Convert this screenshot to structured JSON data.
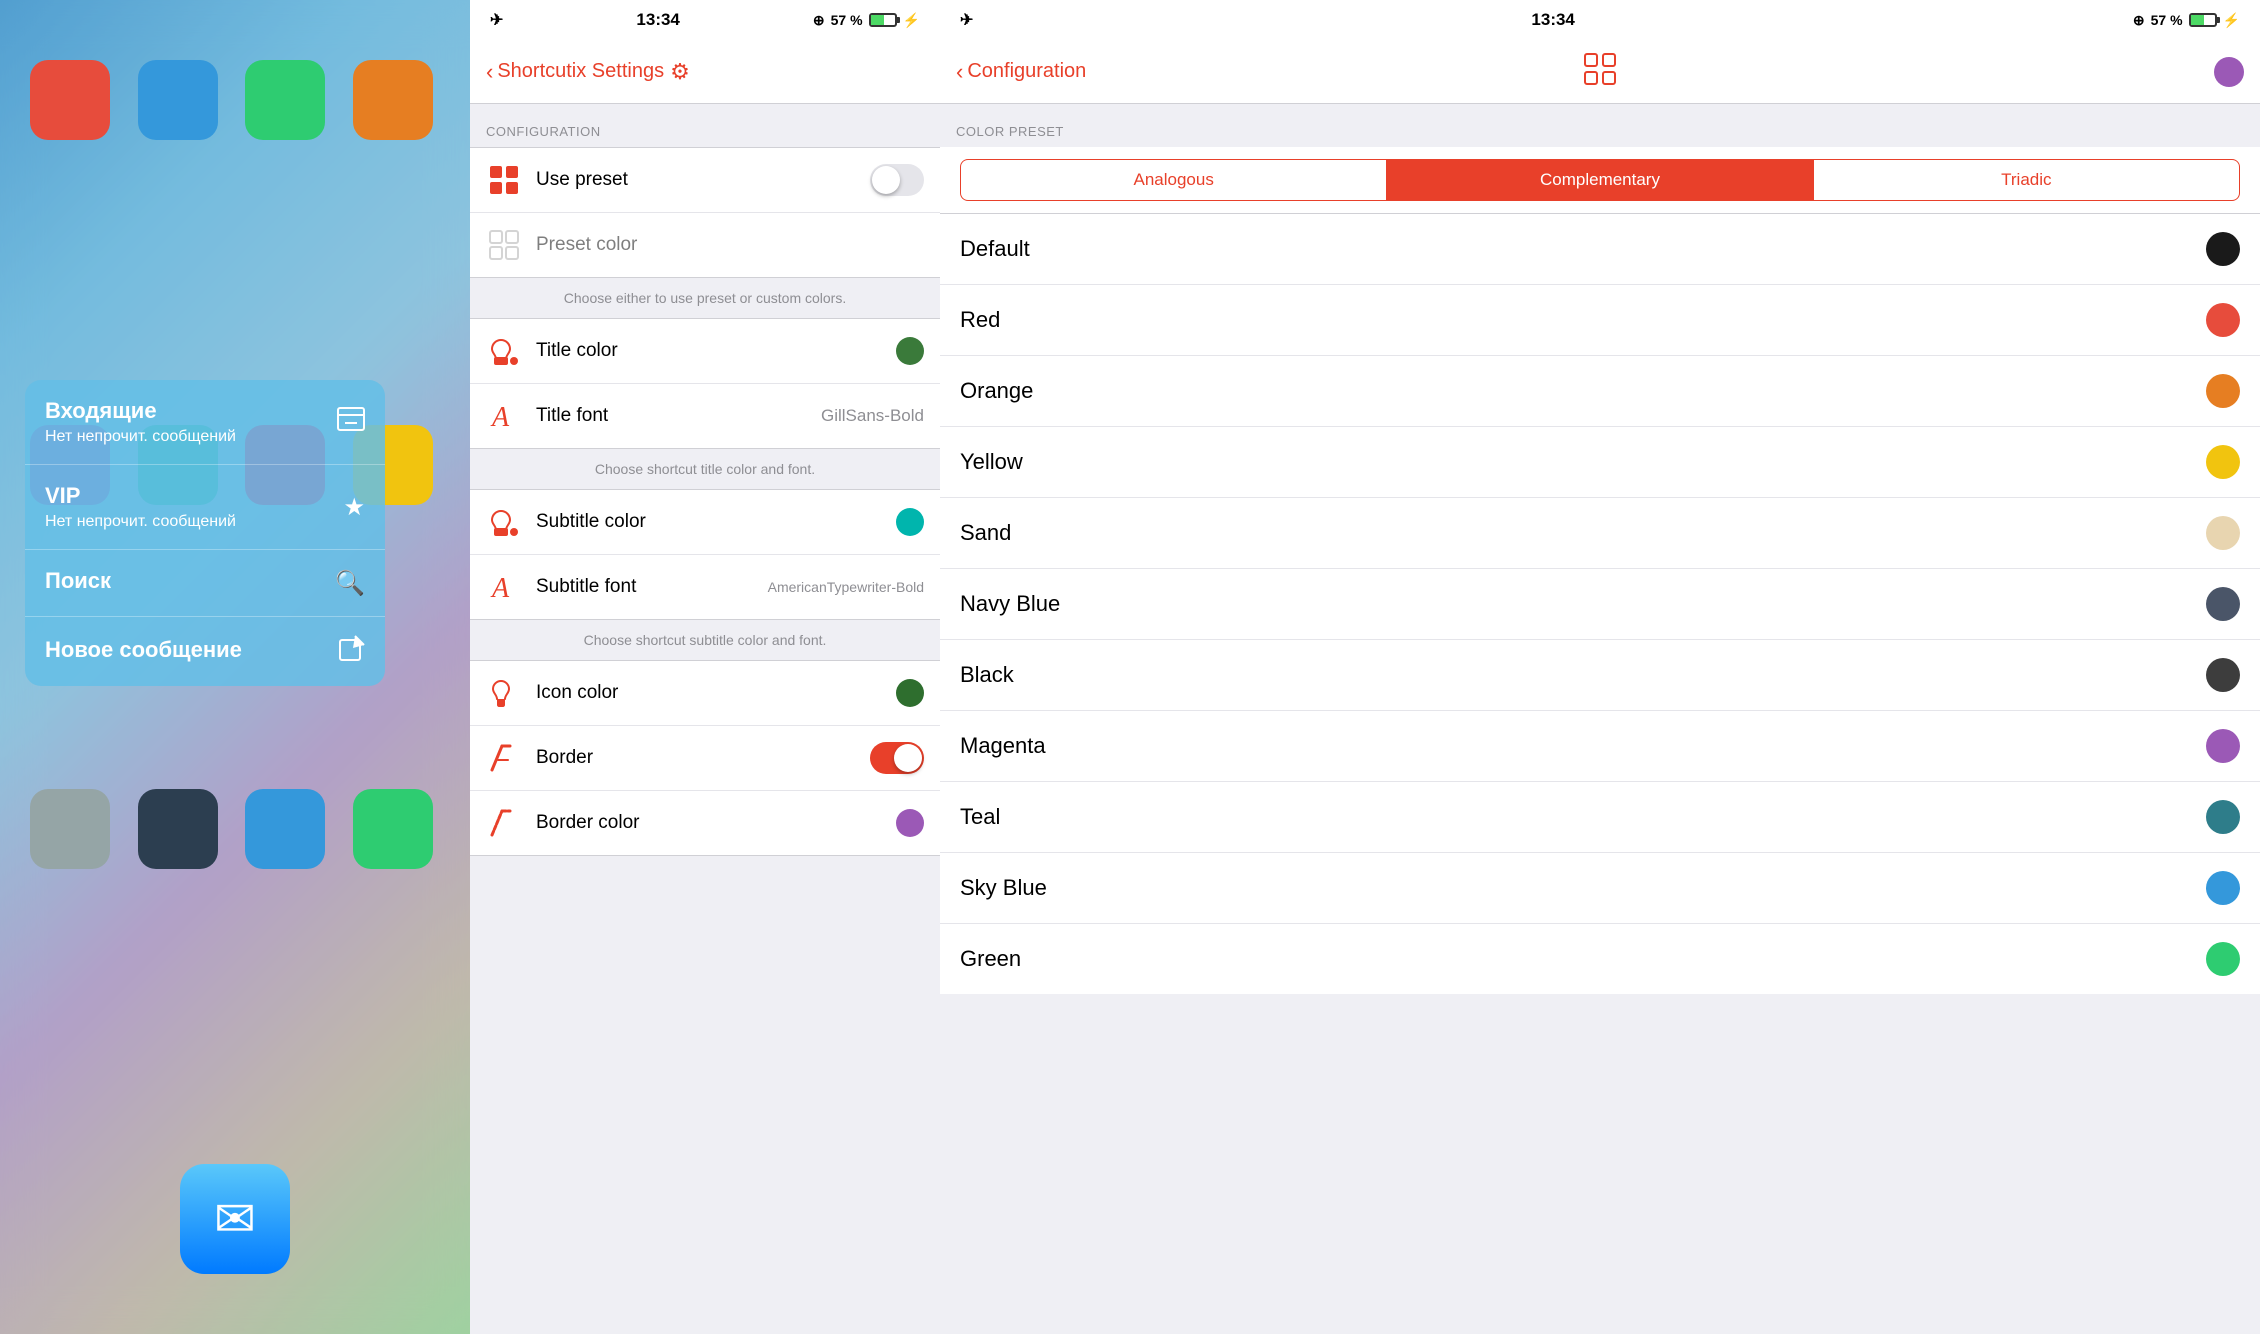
{
  "status_bar": {
    "time": "13:34",
    "battery_percent": "57 %",
    "signal": "⊕"
  },
  "left_panel": {
    "mail_widget": {
      "items": [
        {
          "title": "Входящие",
          "subtitle": "Нет непрочит. сообщений",
          "icon": "inbox"
        },
        {
          "title": "VIP",
          "subtitle": "Нет непрочит. сообщений",
          "icon": "star"
        },
        {
          "title": "Поиск",
          "subtitle": "",
          "icon": "search"
        },
        {
          "title": "Новое сообщение",
          "subtitle": "",
          "icon": "compose"
        }
      ]
    }
  },
  "middle_panel": {
    "nav": {
      "back_label": "Shortcutix Settings",
      "gear_icon": "⚙"
    },
    "section_header": "CONFIGURATION",
    "items": [
      {
        "id": "use-preset",
        "label": "Use preset",
        "type": "toggle",
        "value": false,
        "icon": "grid"
      },
      {
        "id": "preset-color",
        "label": "Preset color",
        "type": "color",
        "disabled": true,
        "icon": "grid-outline"
      },
      {
        "info": "Choose either to use preset or custom colors."
      },
      {
        "id": "title-color",
        "label": "Title color",
        "type": "color-dot",
        "color": "green",
        "icon": "paint-bucket"
      },
      {
        "id": "title-font",
        "label": "Title font",
        "type": "text",
        "value": "GillSans-Bold",
        "icon": "font-a"
      },
      {
        "info": "Choose shortcut title color and font."
      },
      {
        "id": "subtitle-color",
        "label": "Subtitle color",
        "type": "color-dot",
        "color": "teal-bright",
        "icon": "paint-bucket"
      },
      {
        "id": "subtitle-font",
        "label": "Subtitle font",
        "type": "text",
        "value": "AmericanTypewriter-Bold",
        "icon": "font-a"
      },
      {
        "info": "Choose shortcut subtitle color and font."
      },
      {
        "id": "icon-color",
        "label": "Icon color",
        "type": "color-dot",
        "color": "dark-green",
        "icon": "paint-bucket-outline"
      },
      {
        "id": "border",
        "label": "Border",
        "type": "toggle",
        "value": true,
        "icon": "border"
      },
      {
        "id": "border-color",
        "label": "Border color",
        "type": "color-dot",
        "color": "purple",
        "icon": "border-outline"
      }
    ]
  },
  "right_panel": {
    "nav": {
      "back_label": "Configuration",
      "grid_icon": "▦",
      "color_dot": "purple"
    },
    "section_header": "COLOR PRESET",
    "tabs": [
      {
        "id": "analogous",
        "label": "Analogous",
        "active": false
      },
      {
        "id": "complementary",
        "label": "Complementary",
        "active": true
      },
      {
        "id": "triadic",
        "label": "Triadic",
        "active": false
      }
    ],
    "color_items": [
      {
        "label": "Default",
        "color": "#1a1a1a"
      },
      {
        "label": "Red",
        "color": "#e74c3c"
      },
      {
        "label": "Orange",
        "color": "#e67e22"
      },
      {
        "label": "Yellow",
        "color": "#f1c40f"
      },
      {
        "label": "Sand",
        "color": "#e8d5b0"
      },
      {
        "label": "Navy Blue",
        "color": "#4a5568"
      },
      {
        "label": "Black",
        "color": "#3d3d3d"
      },
      {
        "label": "Magenta",
        "color": "#9b59b6"
      },
      {
        "label": "Teal",
        "color": "#2e7d8a"
      },
      {
        "label": "Sky Blue",
        "color": "#3498db"
      },
      {
        "label": "Green",
        "color": "#2ecc71"
      }
    ]
  }
}
